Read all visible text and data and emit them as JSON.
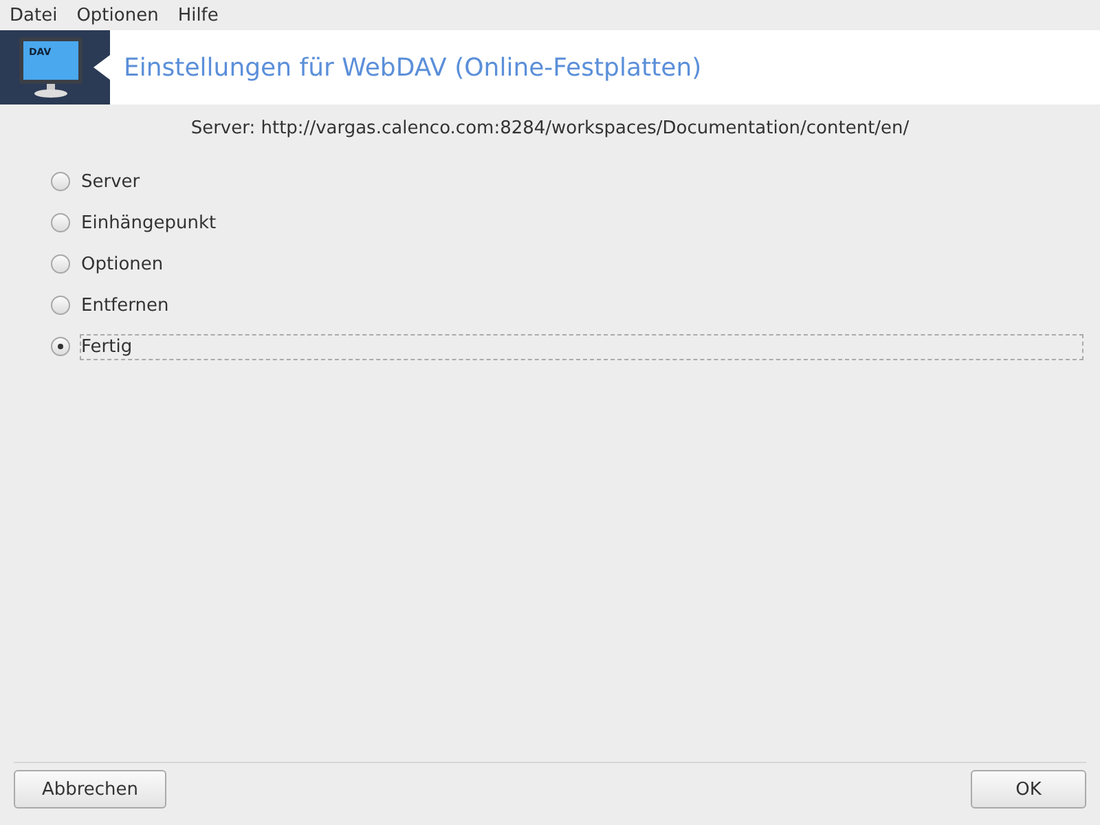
{
  "menu": [
    "Datei",
    "Optionen",
    "Hilfe"
  ],
  "banner": {
    "title": "Einstellungen für WebDAV (Online-Festplatten)",
    "icon_label": "DAV"
  },
  "server_line": "Server: http://vargas.calenco.com:8284/workspaces/Documentation/content/en/",
  "options": [
    {
      "label": "Server",
      "selected": false
    },
    {
      "label": "Einhängepunkt",
      "selected": false
    },
    {
      "label": "Optionen",
      "selected": false
    },
    {
      "label": "Entfernen",
      "selected": false
    },
    {
      "label": "Fertig",
      "selected": true
    }
  ],
  "buttons": {
    "cancel": "Abbrechen",
    "ok": "OK"
  }
}
